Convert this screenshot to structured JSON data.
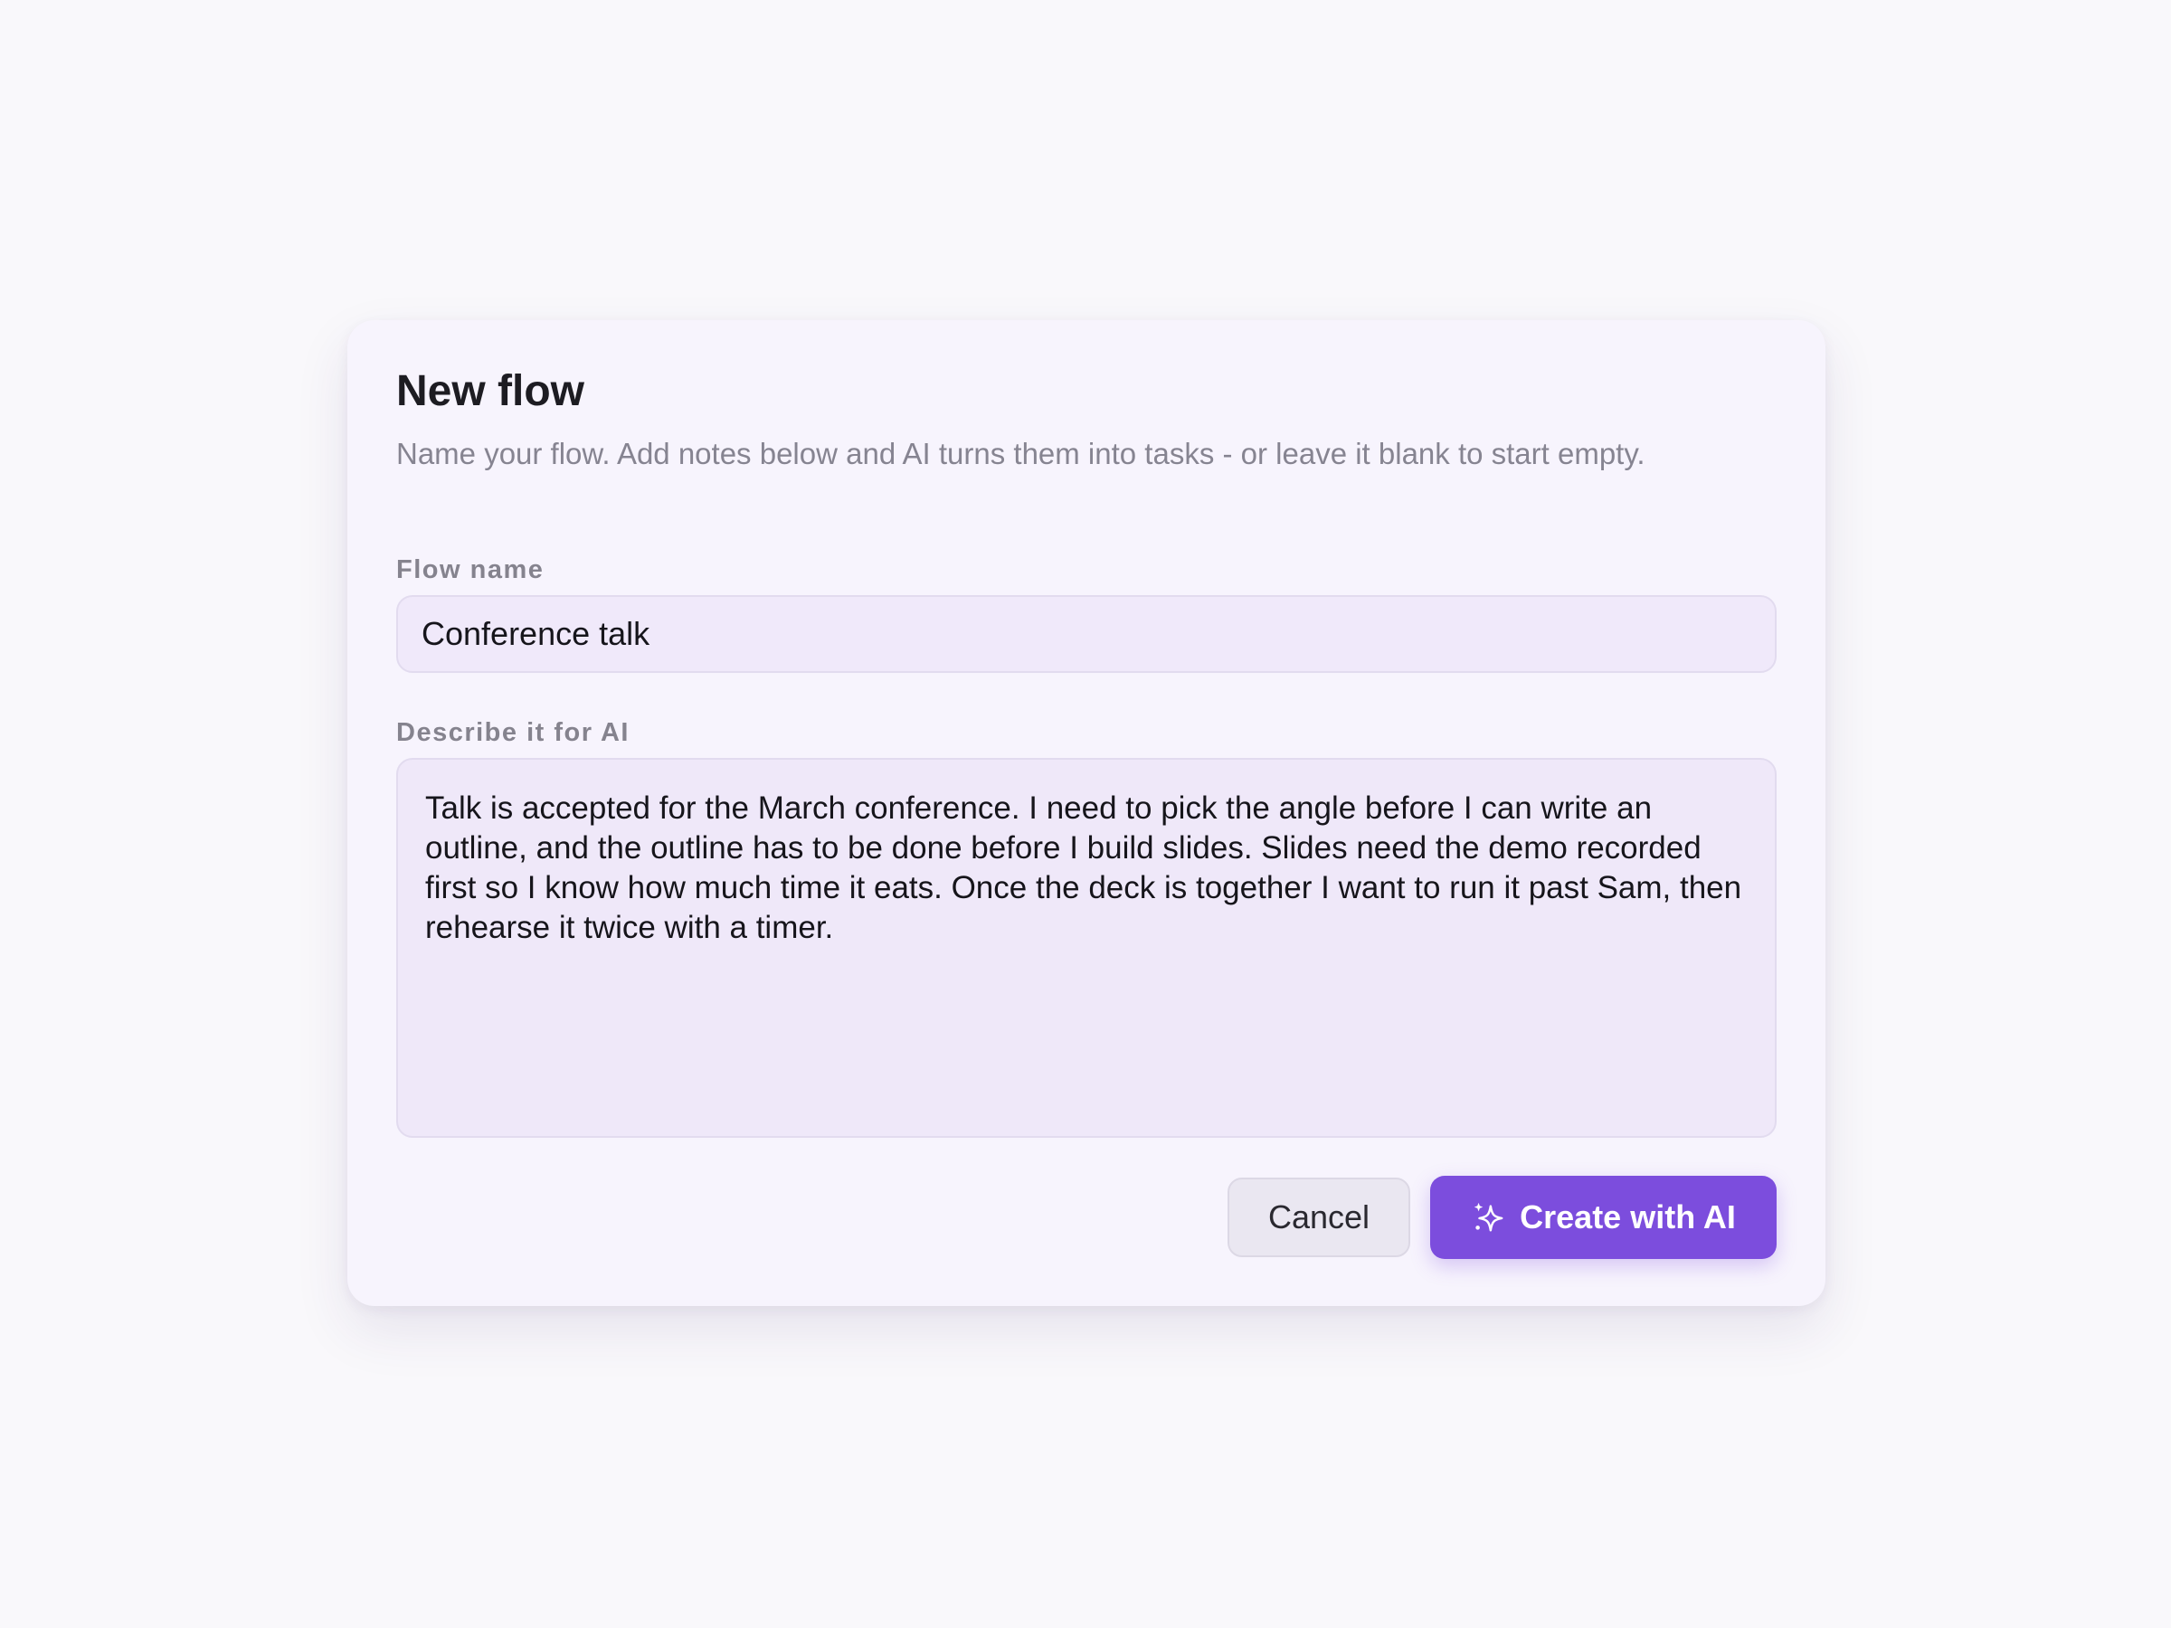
{
  "dialog": {
    "title": "New flow",
    "subtitle": "Name your flow. Add notes below and AI turns them into tasks - or leave it blank to start empty.",
    "flow_name": {
      "label": "Flow name",
      "value": "Conference talk"
    },
    "description": {
      "label": "Describe it for AI",
      "value": "Talk is accepted for the March conference. I need to pick the angle before I can write an outline, and the outline has to be done before I build slides. Slides need the demo recorded first so I know how much time it eats. Once the deck is together I want to run it past Sam, then rehearse it twice with a timer."
    },
    "actions": {
      "cancel_label": "Cancel",
      "create_label": "Create with AI",
      "create_icon": "sparkle-icon"
    }
  },
  "colors": {
    "accent": "#7c4ddd",
    "dialog_background": "#f7f4fd",
    "input_background": "#f0e9fa"
  }
}
